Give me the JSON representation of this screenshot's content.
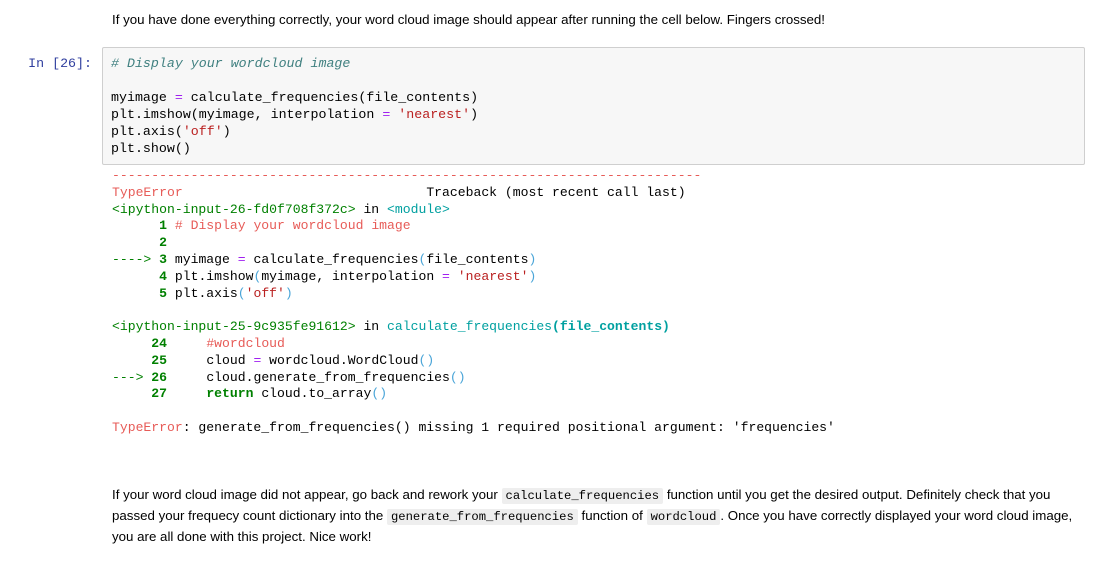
{
  "notebook": {
    "intro_text": "If you have done everything correctly, your word cloud image should appear after running the cell below. Fingers crossed!",
    "cell": {
      "prompt": "In [26]:",
      "code_lines": [
        "# Display your wordcloud image",
        "",
        "myimage = calculate_frequencies(file_contents)",
        "plt.imshow(myimage, interpolation = 'nearest')",
        "plt.axis('off')",
        "plt.show()"
      ]
    },
    "traceback": {
      "separator": "---------------------------------------------------------------------------",
      "error_type": "TypeError",
      "header_right": "Traceback (most recent call last)",
      "frames": [
        {
          "file": "<ipython-input-26-fd0f708f372c>",
          "in_keyword": "in",
          "scope": "<module>",
          "lines": [
            {
              "marker": "",
              "number": "1",
              "code": "# Display your wordcloud image"
            },
            {
              "marker": "",
              "number": "2",
              "code": ""
            },
            {
              "marker": "---->",
              "number": "3",
              "code": "myimage = calculate_frequencies(file_contents)"
            },
            {
              "marker": "",
              "number": "4",
              "code": "plt.imshow(myimage, interpolation = 'nearest')"
            },
            {
              "marker": "",
              "number": "5",
              "code": "plt.axis('off')"
            }
          ]
        },
        {
          "file": "<ipython-input-25-9c935fe91612>",
          "in_keyword": "in",
          "scope": "calculate_frequencies(file_contents)",
          "lines": [
            {
              "marker": "",
              "number": "24",
              "code": "    #wordcloud"
            },
            {
              "marker": "",
              "number": "25",
              "code": "    cloud = wordcloud.WordCloud()"
            },
            {
              "marker": "--->",
              "number": "26",
              "code": "    cloud.generate_from_frequencies()"
            },
            {
              "marker": "",
              "number": "27",
              "code": "    return cloud.to_array()"
            }
          ]
        }
      ],
      "final_error_type": "TypeError",
      "final_error_message": ": generate_from_frequencies() missing 1 required positional argument: 'frequencies'"
    },
    "outro": {
      "part1": "If your word cloud image did not appear, go back and rework your ",
      "code1": "calculate_frequencies",
      "part2": " function until you get the desired output. Definitely check that you passed your frequecy count dictionary into the ",
      "code2": "generate_from_frequencies",
      "part3": " function of ",
      "code3": "wordcloud",
      "part4": ". Once you have correctly displayed your word cloud image, you are all done with this project. Nice work!"
    }
  },
  "colors": {
    "error_red": "#e75c58",
    "traceback_green": "#008000",
    "function_cyan": "#00A0A0",
    "string_red": "#BA2121",
    "operator_purple": "#A020F0",
    "comment_teal": "#408080",
    "prompt_blue": "#303F9F",
    "cell_background": "#f7f7f7",
    "cell_border": "#cfcfcf",
    "inline_code_bg": "#eeeeee"
  }
}
